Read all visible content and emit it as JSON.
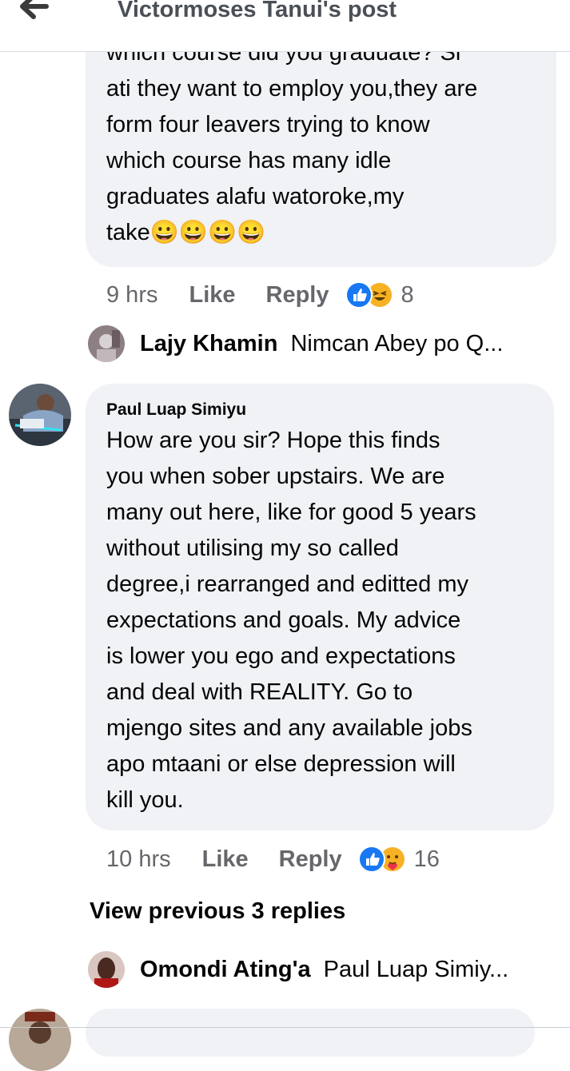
{
  "header": {
    "title": "Victormoses Tanui's post"
  },
  "comments": [
    {
      "text_lines": [
        "which course did you graduate? Si",
        "ati they want to employ you,they are",
        "form four leavers trying to know",
        "which course has many idle",
        "graduates alafu watoroke,my",
        "take😀😀😀😀"
      ],
      "time": "9 hrs",
      "like_label": "Like",
      "reply_label": "Reply",
      "reaction_icons": [
        "like-icon",
        "laughing-emoji-icon"
      ],
      "reaction_count": "8",
      "top_reply": {
        "name": "Lajy Khamin",
        "snippet": "Nimcan Abey po Q..."
      }
    },
    {
      "author": "Paul Luap Simiyu",
      "text_lines": [
        "How are you sir? Hope this finds",
        "you when sober upstairs. We are",
        "many out here, like for good 5 years",
        "without utilising my so called",
        "degree,i rearranged and editted my",
        "expectations and goals. My advice",
        "is lower you ego and expectations",
        "and deal with REALITY. Go to",
        "mjengo sites and any available jobs",
        "apo mtaani or else depression will",
        "kill you."
      ],
      "time": "10 hrs",
      "like_label": "Like",
      "reply_label": "Reply",
      "reaction_icons": [
        "like-icon",
        "care-emoji-icon"
      ],
      "reaction_count": "16",
      "view_previous": "View previous 3 replies",
      "top_reply": {
        "name": "Omondi Ating'a",
        "snippet": "Paul Luap Simiy..."
      }
    }
  ],
  "colors": {
    "bubble": "#f0f2f5",
    "meta_text": "#65676b",
    "like_blue": "#1877f2",
    "emoji_yellow": "#f7b125"
  }
}
